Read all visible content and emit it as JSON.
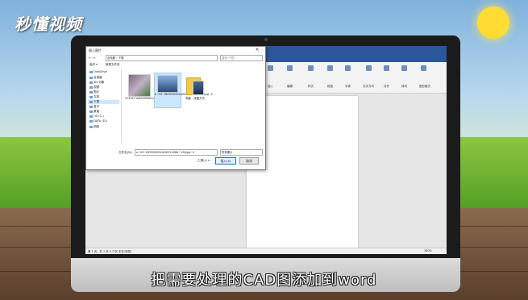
{
  "brand": {
    "logo_text": "秒懂视频"
  },
  "subtitle": {
    "text": "把需要处理的CAD图添加到word"
  },
  "dialog": {
    "title": "插入图片",
    "breadcrumb": "此电脑 › 下载",
    "search_placeholder": "搜索\"下载\"",
    "toolbar": {
      "organize": "组织 ▾",
      "new_folder": "新建文件夹"
    },
    "nav_items": [
      {
        "label": "OneDrive",
        "selected": false
      },
      {
        "label": "此电脑",
        "selected": false
      },
      {
        "label": "3D 对象",
        "selected": false
      },
      {
        "label": "视频",
        "selected": false
      },
      {
        "label": "图片",
        "selected": false
      },
      {
        "label": "文档",
        "selected": false
      },
      {
        "label": "下载",
        "selected": true
      },
      {
        "label": "音乐",
        "selected": false
      },
      {
        "label": "桌面",
        "selected": false
      },
      {
        "label": "OS (C:)",
        "selected": false
      },
      {
        "label": "DATA (D:)",
        "selected": false
      },
      {
        "label": "网络",
        "selected": false
      }
    ],
    "files": [
      {
        "name": "4743471e695983b2e10c"
      },
      {
        "name": "a~09~f8f9930902d300f1168b~236jpg~0"
      },
      {
        "name": ""
      },
      {
        "name": "电脑 - 快捷方式"
      }
    ],
    "filename_label": "文件名(N):",
    "filename_value": "a~09~f8f9930902d300f1168b~236jpg~0",
    "filetype_value": "所有图片",
    "tools_label": "工具(L) ▾",
    "insert_label": "插入(S)",
    "cancel_label": "取消"
  },
  "word": {
    "ribbon_labels": [
      "插入",
      "编辑",
      "样式",
      "段落",
      "字体",
      "文字方向",
      "对齐",
      "排列",
      "图形格式"
    ],
    "status_left": "第 1 页，共 1 页  0 个字  中文(中国)",
    "status_right": "100%"
  },
  "colors": {
    "word_blue": "#2b579a",
    "dialog_select": "#cce8ff",
    "sun": "#ffdd33",
    "grass": "#6cb030"
  }
}
